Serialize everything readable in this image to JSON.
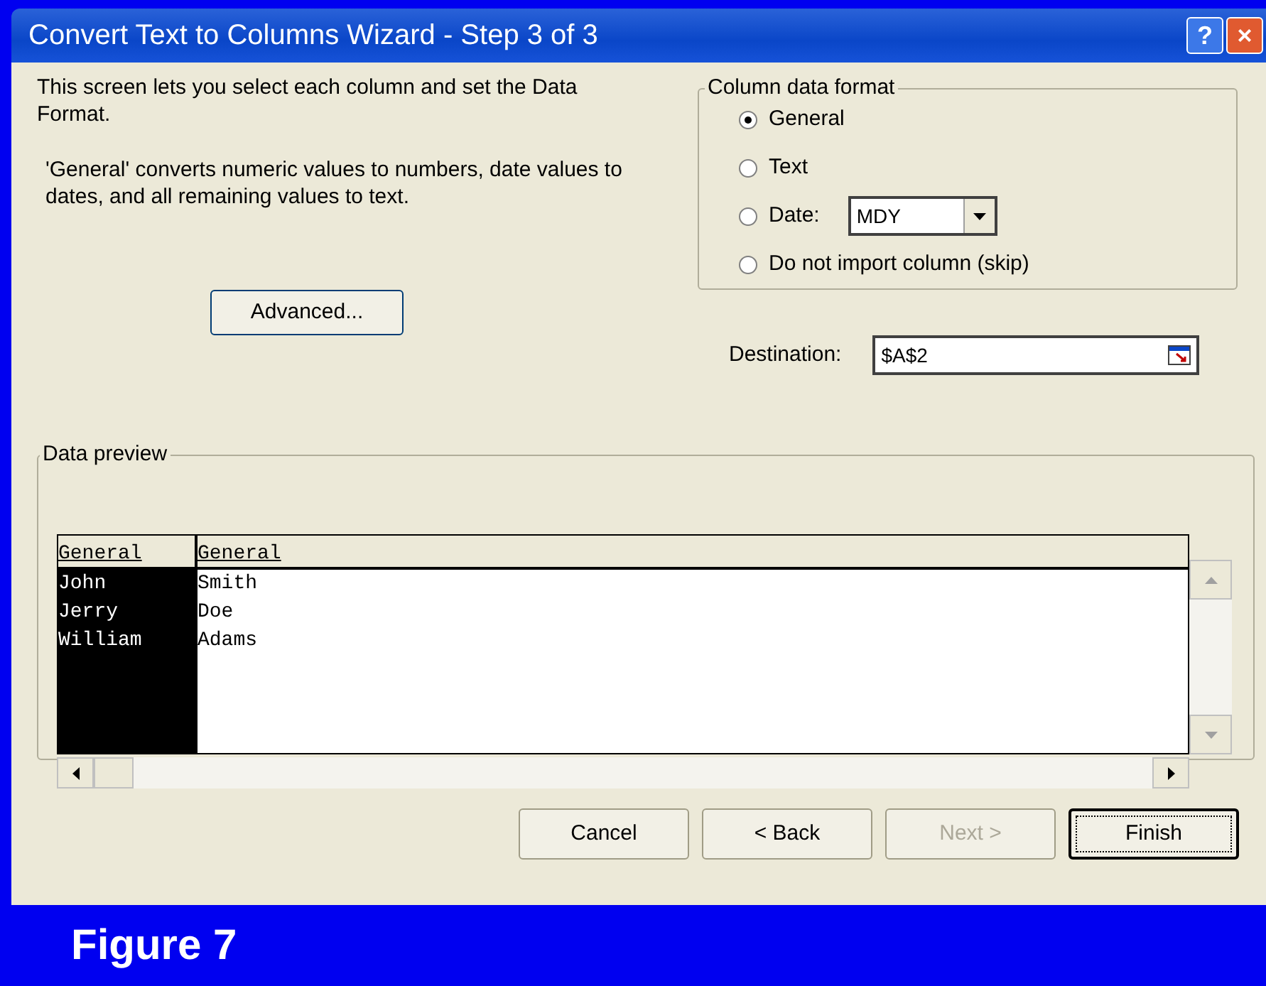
{
  "window": {
    "title": "Convert Text to Columns Wizard - Step 3 of 3",
    "title_buttons": [
      "?",
      "×"
    ]
  },
  "intro": "This screen lets you select each column and set the Data Format.",
  "explanation": "'General' converts numeric values to numbers, date values to dates, and all remaining values to text.",
  "advanced_button": "Advanced...",
  "column_data_format": {
    "title": "Column data format",
    "options": [
      {
        "label": "General",
        "selected": true
      },
      {
        "label": "Text",
        "selected": false
      },
      {
        "label": "Date:",
        "selected": false,
        "kind": "date",
        "value": "MDY"
      },
      {
        "label": "Do not import column (skip)",
        "selected": false
      }
    ]
  },
  "destination": {
    "label": "Destination:",
    "value": "$A$2"
  },
  "data_preview": {
    "title": "Data preview",
    "columns": [
      {
        "header": "General",
        "selected": true,
        "cells": [
          "John",
          "Jerry",
          "William"
        ]
      },
      {
        "header": "General",
        "selected": false,
        "cells": [
          "Smith",
          "Doe",
          "Adams"
        ]
      }
    ]
  },
  "buttons": [
    {
      "label": "Cancel",
      "disabled": false,
      "default": false
    },
    {
      "label": "< Back",
      "disabled": false,
      "default": false
    },
    {
      "label": "Next >",
      "disabled": true,
      "default": false
    },
    {
      "label": "Finish",
      "disabled": false,
      "default": true
    }
  ],
  "caption": "Figure 7"
}
